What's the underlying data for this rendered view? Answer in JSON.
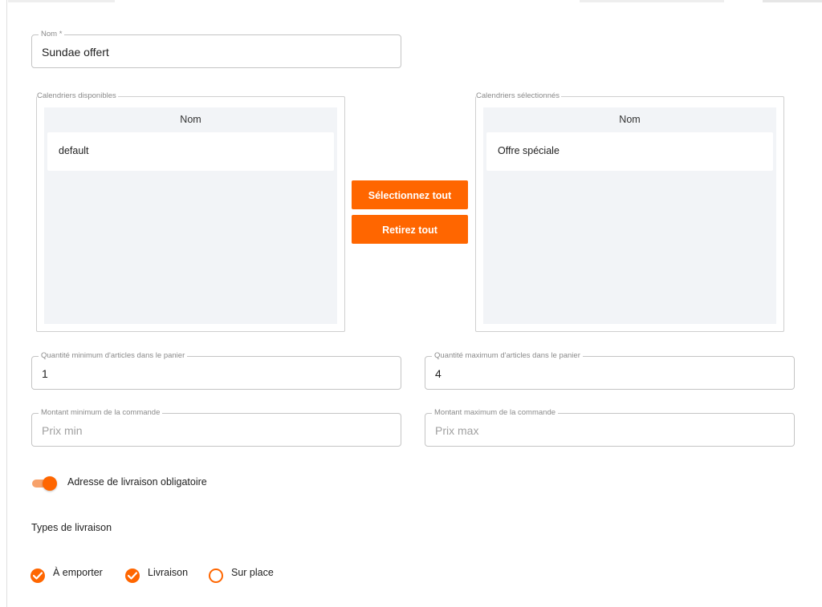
{
  "name_field": {
    "label": "Nom *",
    "value": "Sundae offert"
  },
  "available_calendars": {
    "label": "Calendriers disponibles",
    "column_header": "Nom",
    "rows": [
      "default"
    ]
  },
  "selected_calendars": {
    "label": "Calendriers sélectionnés",
    "column_header": "Nom",
    "rows": [
      "Offre spéciale"
    ]
  },
  "buttons": {
    "select_all": "Sélectionnez tout",
    "remove_all": "Retirez tout"
  },
  "min_quantity": {
    "label": "Quantité minimum d'articles dans le panier",
    "value": "1"
  },
  "max_quantity": {
    "label": "Quantité maximum d'articles dans le panier",
    "value": "4"
  },
  "min_amount": {
    "label": "Montant minimum de la commande",
    "placeholder": "Prix min"
  },
  "max_amount": {
    "label": "Montant maximum de la commande",
    "placeholder": "Prix max"
  },
  "delivery_address_toggle": {
    "label": "Adresse de livraison obligatoire",
    "on": true
  },
  "delivery_types": {
    "title": "Types de livraison",
    "options": [
      {
        "label": "À emporter",
        "checked": true
      },
      {
        "label": "Livraison",
        "checked": true
      },
      {
        "label": "Sur place",
        "checked": false
      }
    ]
  },
  "colors": {
    "accent": "#ff6600",
    "accent_light": "#f7a26b",
    "list_bg": "#f2f4f7"
  },
  "icons": {
    "checked": "check-circle-icon",
    "unchecked": "empty-circle-icon"
  }
}
